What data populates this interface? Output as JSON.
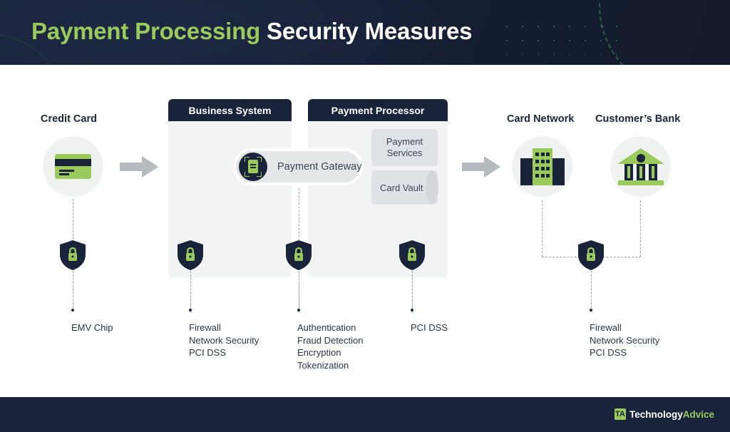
{
  "header": {
    "title_green": "Payment Processing",
    "title_white": " Security Measures",
    "accent_green": "#9aca5c",
    "navy": "#19233a"
  },
  "diagram": {
    "captions": {
      "credit_card": "Credit Card",
      "card_network": "Card Network",
      "customers_bank": "Customer’s Bank"
    },
    "boxes": [
      {
        "title": "Business System"
      },
      {
        "title": "Payment Processor"
      }
    ],
    "gateway": {
      "label": "Payment Gateway",
      "icon": "document-scan-icon"
    },
    "processor_items": [
      {
        "label": "Payment Services",
        "shape": "box"
      },
      {
        "label": "Card Vault",
        "shape": "cylinder"
      }
    ],
    "icons": {
      "credit_card": "credit-card-icon",
      "card_network": "office-building-icon",
      "customers_bank": "bank-icon",
      "shield": "shield-lock-icon",
      "arrow": "arrow-right-icon"
    },
    "security_groups": [
      {
        "id": "emv",
        "items": [
          "EMV Chip"
        ]
      },
      {
        "id": "business-system",
        "items": [
          "Firewall",
          "Network Security",
          "PCI DSS"
        ]
      },
      {
        "id": "gateway",
        "items": [
          "Authentication",
          "Fraud Detection",
          "Encryption",
          "Tokenization"
        ]
      },
      {
        "id": "processor",
        "items": [
          "PCI DSS"
        ]
      },
      {
        "id": "network-bank",
        "items": [
          "Firewall",
          "Network Security",
          "PCI DSS"
        ]
      }
    ]
  },
  "footer": {
    "logo_mark": "TA",
    "brand_first": "Technology",
    "brand_second": "Advice"
  }
}
